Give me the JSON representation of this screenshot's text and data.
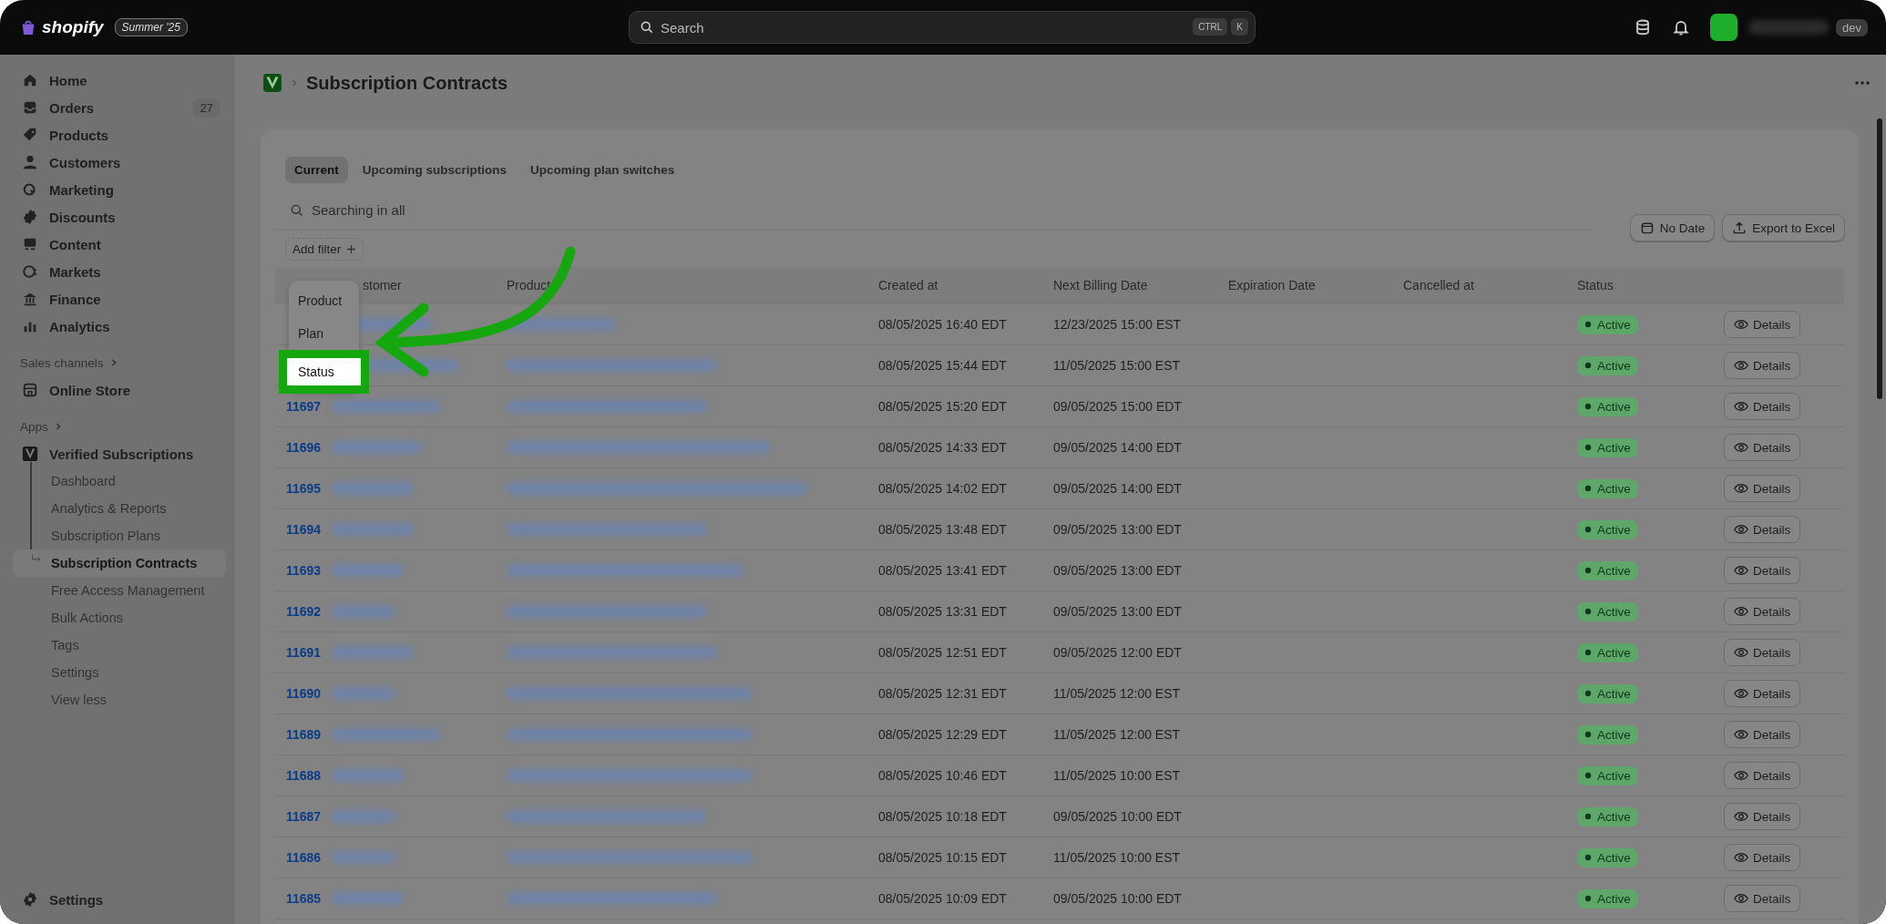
{
  "topbar": {
    "brand": "shopify",
    "edition": "Summer '25",
    "search": {
      "placeholder": "Search"
    },
    "shortcut_keys": [
      "CTRL",
      "K"
    ],
    "account": "dev"
  },
  "sidebar": {
    "items": [
      {
        "label": "Home"
      },
      {
        "label": "Orders",
        "badge": "27"
      },
      {
        "label": "Products"
      },
      {
        "label": "Customers"
      },
      {
        "label": "Marketing"
      },
      {
        "label": "Discounts"
      },
      {
        "label": "Content"
      },
      {
        "label": "Markets"
      },
      {
        "label": "Finance"
      },
      {
        "label": "Analytics"
      }
    ],
    "sales_channels": {
      "heading": "Sales channels",
      "items": [
        {
          "label": "Online Store"
        }
      ]
    },
    "apps": {
      "heading": "Apps",
      "app": {
        "label": "Verified Subscriptions",
        "children": [
          {
            "label": "Dashboard",
            "selected": false
          },
          {
            "label": "Analytics & Reports",
            "selected": false
          },
          {
            "label": "Subscription Plans",
            "selected": false
          },
          {
            "label": "Subscription Contracts",
            "selected": true
          },
          {
            "label": "Free Access Management",
            "selected": false
          },
          {
            "label": "Bulk Actions",
            "selected": false
          },
          {
            "label": "Tags",
            "selected": false
          },
          {
            "label": "Settings",
            "selected": false
          },
          {
            "label": "View less",
            "selected": false
          }
        ]
      }
    },
    "footer": {
      "label": "Settings"
    }
  },
  "page": {
    "title": "Subscription Contracts"
  },
  "tabs": [
    {
      "label": "Current",
      "selected": true
    },
    {
      "label": "Upcoming subscriptions",
      "selected": false
    },
    {
      "label": "Upcoming plan switches",
      "selected": false
    }
  ],
  "search": {
    "placeholder": "Searching in all"
  },
  "add_filter": {
    "label": "Add filter",
    "options": [
      {
        "label": "Product",
        "selected": false
      },
      {
        "label": "Plan",
        "selected": false
      },
      {
        "label": "Status",
        "selected": true
      }
    ]
  },
  "actions": [
    {
      "label": "No Date"
    },
    {
      "label": "Export to Excel"
    }
  ],
  "table": {
    "columns": [
      "stomer",
      "Product",
      "Created at",
      "Next Billing Date",
      "Expiration Date",
      "Cancelled at",
      "Status"
    ],
    "rows": [
      {
        "created": "08/05/2025 16:40 EDT",
        "next_billing": "12/23/2025 15:00 EST",
        "status": "Active",
        "action": "Details"
      },
      {
        "created": "08/05/2025 15:44 EDT",
        "next_billing": "11/05/2025 15:00 EST",
        "status": "Active",
        "action": "Details"
      },
      {
        "id": "11697",
        "created": "08/05/2025 15:20 EDT",
        "next_billing": "09/05/2025 15:00 EDT",
        "status": "Active",
        "action": "Details"
      },
      {
        "id": "11696",
        "created": "08/05/2025 14:33 EDT",
        "next_billing": "09/05/2025 14:00 EDT",
        "status": "Active",
        "action": "Details"
      },
      {
        "id": "11695",
        "created": "08/05/2025 14:02 EDT",
        "next_billing": "09/05/2025 14:00 EDT",
        "status": "Active",
        "action": "Details"
      },
      {
        "id": "11694",
        "created": "08/05/2025 13:48 EDT",
        "next_billing": "09/05/2025 13:00 EDT",
        "status": "Active",
        "action": "Details"
      },
      {
        "id": "11693",
        "created": "08/05/2025 13:41 EDT",
        "next_billing": "09/05/2025 13:00 EDT",
        "status": "Active",
        "action": "Details"
      },
      {
        "id": "11692",
        "created": "08/05/2025 13:31 EDT",
        "next_billing": "09/05/2025 13:00 EDT",
        "status": "Active",
        "action": "Details"
      },
      {
        "id": "11691",
        "created": "08/05/2025 12:51 EDT",
        "next_billing": "09/05/2025 12:00 EDT",
        "status": "Active",
        "action": "Details"
      },
      {
        "id": "11690",
        "created": "08/05/2025 12:31 EDT",
        "next_billing": "11/05/2025 12:00 EST",
        "status": "Active",
        "action": "Details"
      },
      {
        "id": "11689",
        "created": "08/05/2025 12:29 EDT",
        "next_billing": "11/05/2025 12:00 EST",
        "status": "Active",
        "action": "Details"
      },
      {
        "id": "11688",
        "created": "08/05/2025 10:46 EDT",
        "next_billing": "11/05/2025 10:00 EST",
        "status": "Active",
        "action": "Details"
      },
      {
        "id": "11687",
        "created": "08/05/2025 10:18 EDT",
        "next_billing": "09/05/2025 10:00 EDT",
        "status": "Active",
        "action": "Details"
      },
      {
        "id": "11686",
        "created": "08/05/2025 10:15 EDT",
        "next_billing": "11/05/2025 10:00 EST",
        "status": "Active",
        "action": "Details"
      },
      {
        "id": "11685",
        "created": "08/05/2025 10:09 EDT",
        "next_billing": "09/05/2025 10:00 EDT",
        "status": "Active",
        "action": "Details"
      }
    ]
  }
}
